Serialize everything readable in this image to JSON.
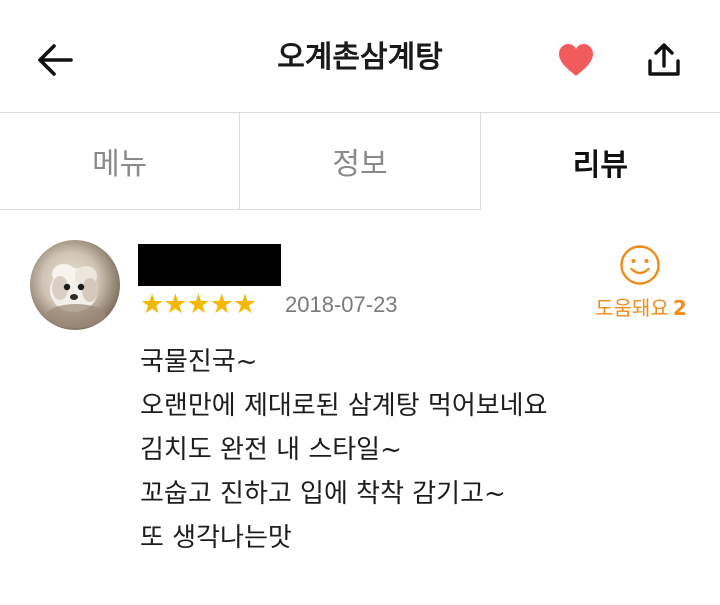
{
  "header": {
    "title": "오계촌삼계탕",
    "back_icon": "arrow-left-icon",
    "favorite_icon": "heart-icon",
    "share_icon": "share-upload-icon",
    "favorite_color": "#f25b5b"
  },
  "tabs": [
    {
      "label": "메뉴",
      "active": false
    },
    {
      "label": "정보",
      "active": false
    },
    {
      "label": "리뷰",
      "active": true
    }
  ],
  "review": {
    "avatar_icon": "user-avatar-dog-photo",
    "reviewer_name": "",
    "rating": 5,
    "rating_text": "★★★★★",
    "date": "2018-07-23",
    "helpful": {
      "label": "도움돼요",
      "count": "2",
      "icon": "smile-icon",
      "color": "#f08c1a"
    },
    "lines": [
      "국물진국~",
      "오랜만에 제대로된 삼계탕 먹어보네요",
      "김치도 완전 내 스타일~",
      "꼬숩고 진하고 입에 착착 감기고~",
      "또 생각나는맛"
    ]
  },
  "colors": {
    "star": "#f5b800",
    "divider": "#dcdcdc",
    "inactive_tab": "#8a8a8a"
  }
}
